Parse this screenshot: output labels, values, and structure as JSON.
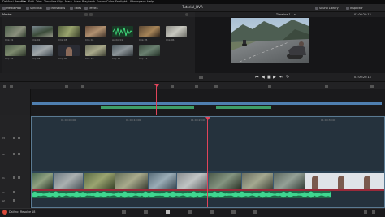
{
  "app": {
    "menu": [
      "DaVinci Resolve",
      "File",
      "Edit",
      "Trim",
      "Timeline",
      "Clip",
      "Mark",
      "View",
      "Playback",
      "Fusion",
      "Color",
      "Fairlight",
      "Workspace",
      "Help"
    ],
    "project_title": "Tutorial_DVR"
  },
  "toolbar": {
    "left": [
      "Media Pool",
      "Sync Bin",
      "Transitions",
      "Titles",
      "Effects"
    ],
    "timeline_name": "Timeline 1",
    "right": [
      "Sound Library",
      "Inspector"
    ]
  },
  "media_pool": {
    "bin_label": "Master",
    "clips": [
      {
        "name": "Clip 01"
      },
      {
        "name": "Clip 02"
      },
      {
        "name": "Clip 03"
      },
      {
        "name": "Clip 04"
      },
      {
        "name": "Audio 01"
      },
      {
        "name": "Clip 05"
      },
      {
        "name": "Clip 06"
      },
      {
        "name": "Clip 07"
      },
      {
        "name": "Clip 08"
      },
      {
        "name": "Clip 09"
      },
      {
        "name": "Clip 10"
      },
      {
        "name": "Clip 11"
      },
      {
        "name": "Clip 12"
      }
    ]
  },
  "viewer": {
    "timecode": "01:00:20:13",
    "zoom": "38%"
  },
  "timeline": {
    "ruler_marks": [
      "01:00:00:00",
      "01:00:10:00",
      "01:00:20:00",
      "01:00:30:00"
    ],
    "track_labels": [
      "V3",
      "V2",
      "V1",
      "A1",
      "A2"
    ],
    "playhead_timecode": "01:00:20:13"
  },
  "bottom": {
    "product": "DaVinci Resolve 18",
    "pages": [
      "Media",
      "Cut",
      "Edit",
      "Fusion",
      "Color",
      "Fairlight",
      "Deliver"
    ]
  }
}
